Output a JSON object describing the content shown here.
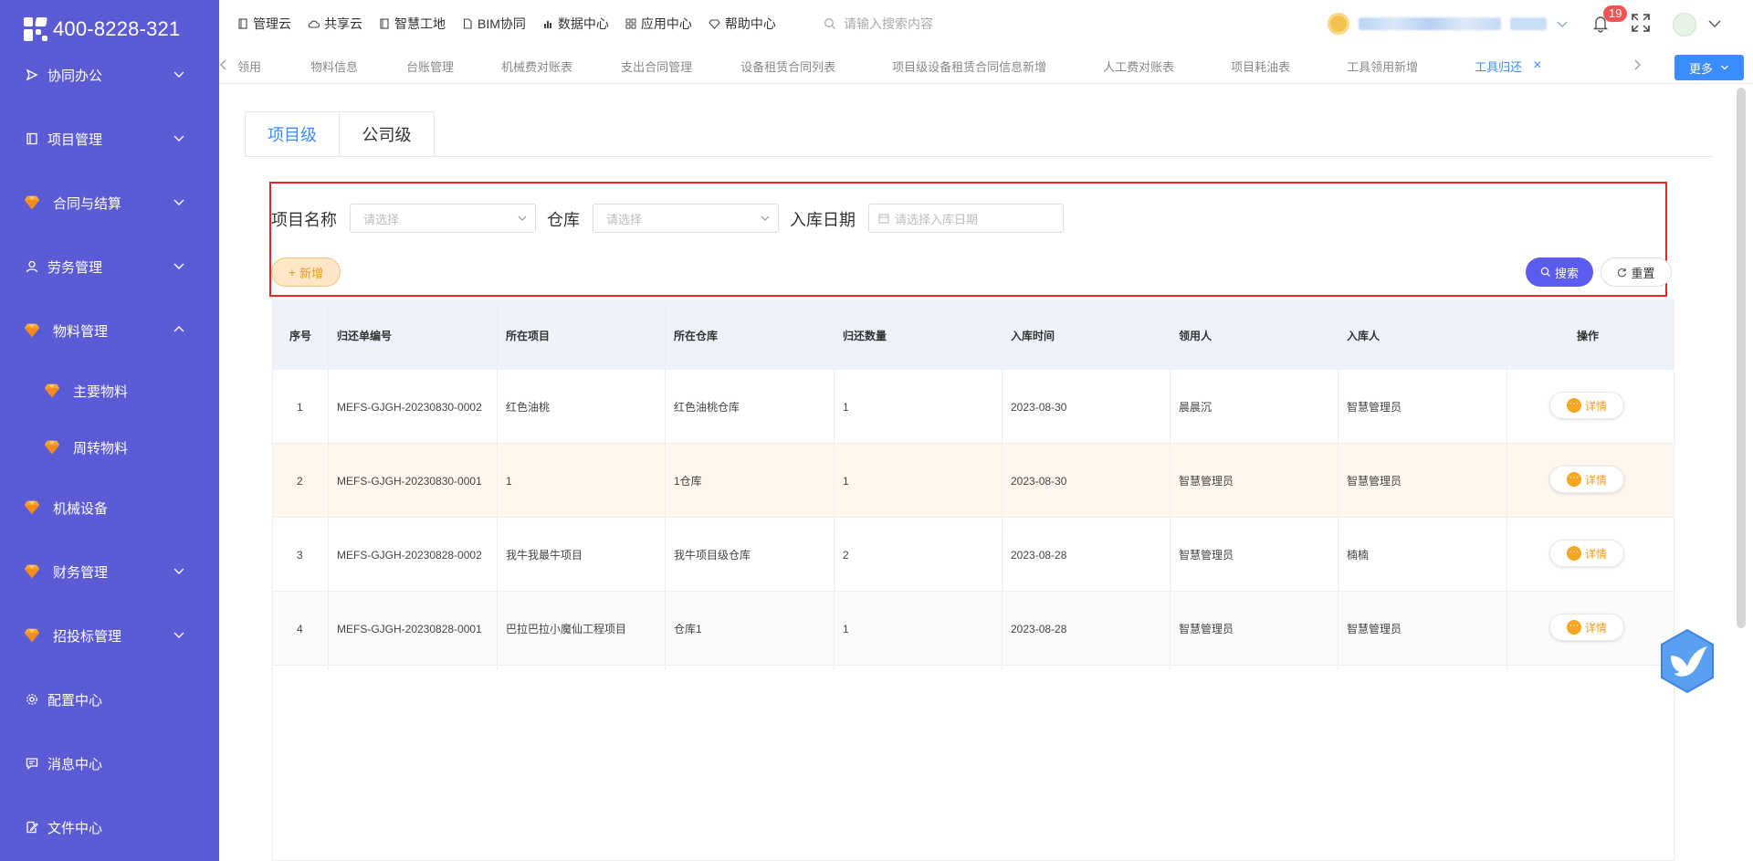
{
  "logo": {
    "phone": "400-8228-321"
  },
  "sidebar": {
    "items": [
      {
        "label": "协同办公",
        "icon": "send-icon",
        "expand": "down"
      },
      {
        "label": "项目管理",
        "icon": "book-icon",
        "expand": "down"
      },
      {
        "label": "合同与结算",
        "icon": "gem-icon",
        "expand": "down"
      },
      {
        "label": "劳务管理",
        "icon": "person-icon",
        "expand": "down"
      },
      {
        "label": "物料管理",
        "icon": "gem-icon",
        "expand": "up"
      },
      {
        "label": "主要物料",
        "icon": "gem-icon",
        "expand": ""
      },
      {
        "label": "周转物料",
        "icon": "gem-icon",
        "expand": ""
      },
      {
        "label": "机械设备",
        "icon": "gem-icon",
        "expand": ""
      },
      {
        "label": "财务管理",
        "icon": "gem-icon",
        "expand": "down"
      },
      {
        "label": "招投标管理",
        "icon": "gem-icon",
        "expand": "down"
      },
      {
        "label": "配置中心",
        "icon": "gear-icon",
        "expand": ""
      },
      {
        "label": "消息中心",
        "icon": "message-icon",
        "expand": ""
      },
      {
        "label": "文件中心",
        "icon": "file-edit-icon",
        "expand": ""
      }
    ]
  },
  "topnav": {
    "items": [
      "管理云",
      "共享云",
      "智慧工地",
      "BIM协同",
      "数据中心",
      "应用中心",
      "帮助中心"
    ],
    "search_placeholder": "请输入搜索内容",
    "notification_count": "19"
  },
  "tabstrip": {
    "tabs": [
      "领用",
      "物料信息",
      "台账管理",
      "机械费对账表",
      "支出合同管理",
      "设备租赁合同列表",
      "项目级设备租赁合同信息新增",
      "人工费对账表",
      "项目耗油表",
      "工具领用新增",
      "工具归还"
    ],
    "active_tab": "工具归还",
    "more_label": "更多"
  },
  "level_tabs": {
    "project": "项目级",
    "company": "公司级"
  },
  "filters": {
    "project_label": "项目名称",
    "project_placeholder": "请选择",
    "warehouse_label": "仓库",
    "warehouse_placeholder": "请选择",
    "date_label": "入库日期",
    "date_placeholder": "请选择入库日期",
    "add_label": "新增",
    "search_label": "搜索",
    "reset_label": "重置"
  },
  "table": {
    "headers": [
      "序号",
      "归还单编号",
      "所在项目",
      "所在仓库",
      "归还数量",
      "入库时间",
      "领用人",
      "入库人",
      "操作"
    ],
    "detail_label": "详情",
    "rows": [
      [
        "1",
        "MEFS-GJGH-20230830-0002",
        "红色油桃",
        "红色油桃仓库",
        "1",
        "2023-08-30",
        "晨晨沉",
        "智慧管理员"
      ],
      [
        "2",
        "MEFS-GJGH-20230830-0001",
        "1",
        "1仓库",
        "1",
        "2023-08-30",
        "智慧管理员",
        "智慧管理员"
      ],
      [
        "3",
        "MEFS-GJGH-20230828-0002",
        "我牛我最牛项目",
        "我牛项目级仓库",
        "2",
        "2023-08-28",
        "智慧管理员",
        "楠楠"
      ],
      [
        "4",
        "MEFS-GJGH-20230828-0001",
        "巴拉巴拉小魔仙工程项目",
        "仓库1",
        "1",
        "2023-08-28",
        "智慧管理员",
        "智慧管理员"
      ]
    ]
  },
  "colors": {
    "sidebar": "#5b5bd6",
    "accent": "#3b8cff",
    "highlight_box": "#e8232b",
    "add_button": "#f39a1e"
  }
}
